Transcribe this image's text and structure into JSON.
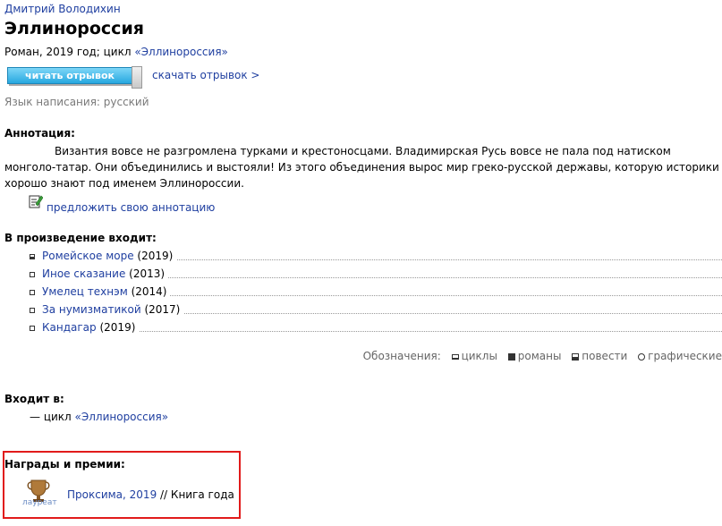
{
  "book": {
    "author": "Дмитрий Володихин",
    "title": "Эллинороссия",
    "meta_prefix": "Роман, 2019 год; цикл ",
    "cycle_link": "«Эллинороссия»",
    "read_button": "читать отрывок",
    "download_link": "скачать отрывок >",
    "language": "Язык написания: русский"
  },
  "annotation": {
    "heading": "Аннотация:",
    "text": "Византия вовсе не разгромлена турками и крестоносцами. Владимирская Русь вовсе не пала под натиском монголо-татар. Они объединились и выстояли! Из этого объединения вырос мир греко-русской державы, которую историки хорошо знают под именем Эллинороссии.",
    "suggest_link": "предложить свою аннотацию"
  },
  "contains": {
    "heading": "В произведение входит:",
    "items": [
      {
        "title": "Ромейское море",
        "year": "(2019)",
        "link": true,
        "marker": "povest"
      },
      {
        "title": "Иное сказание",
        "year": "(2013)",
        "link": true,
        "marker": "rasskaz"
      },
      {
        "title": "Умелец технэм",
        "year": "(2014)",
        "link": true,
        "marker": "rasskaz"
      },
      {
        "title": "За нумизматикой",
        "year": "(2017)",
        "link": true,
        "marker": "rasskaz"
      },
      {
        "title": "Кандагар",
        "year": "(2019)",
        "link": true,
        "marker": "rasskaz"
      }
    ]
  },
  "legend": {
    "label": "Обозначения:",
    "items": [
      "циклы",
      "романы",
      "повести",
      "графические"
    ]
  },
  "belongs": {
    "heading": "Входит в:",
    "prefix": "— цикл ",
    "cycle": "«Эллинороссия»"
  },
  "awards": {
    "heading": "Награды и премии:",
    "badge": "лауреат",
    "award_link": "Проксима, 2019",
    "category": " // Книга года"
  },
  "colors": {
    "link": "#1f3fa0",
    "highlight_box": "#e11b1b",
    "button": "#27a8e0"
  }
}
